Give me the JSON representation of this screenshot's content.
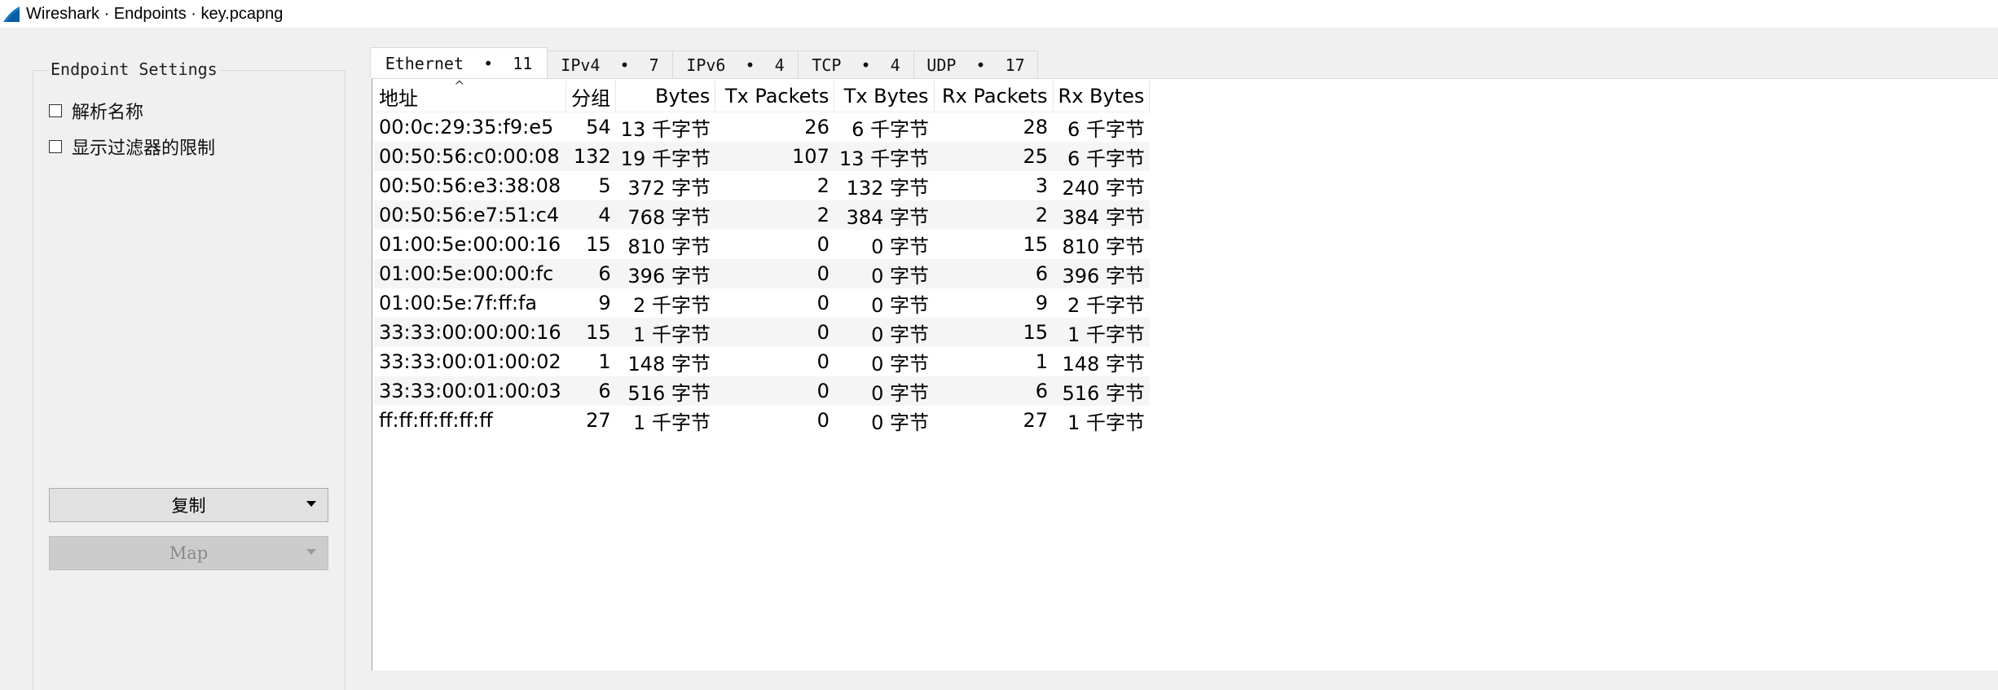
{
  "window": {
    "title": "Wireshark · Endpoints · key.pcapng"
  },
  "settings": {
    "group_title": "Endpoint Settings",
    "resolve_names": "解析名称",
    "limit_to_filter": "显示过滤器的限制",
    "copy_label": "复制",
    "map_label": "Map"
  },
  "tabs": [
    {
      "label": "Ethernet  •  11"
    },
    {
      "label": "IPv4  •  7"
    },
    {
      "label": "IPv6  •  4"
    },
    {
      "label": "TCP  •  4"
    },
    {
      "label": "UDP  •  17"
    }
  ],
  "table": {
    "headers": [
      "地址",
      "分组",
      "Bytes",
      "Tx Packets",
      "Tx Bytes",
      "Rx Packets",
      "Rx Bytes"
    ],
    "rows": [
      [
        "00:0c:29:35:f9:e5",
        "54",
        "13 千字节",
        "26",
        "6 千字节",
        "28",
        "6 千字节"
      ],
      [
        "00:50:56:c0:00:08",
        "132",
        "19 千字节",
        "107",
        "13 千字节",
        "25",
        "6 千字节"
      ],
      [
        "00:50:56:e3:38:08",
        "5",
        "372 字节",
        "2",
        "132 字节",
        "3",
        "240 字节"
      ],
      [
        "00:50:56:e7:51:c4",
        "4",
        "768 字节",
        "2",
        "384 字节",
        "2",
        "384 字节"
      ],
      [
        "01:00:5e:00:00:16",
        "15",
        "810 字节",
        "0",
        "0 字节",
        "15",
        "810 字节"
      ],
      [
        "01:00:5e:00:00:fc",
        "6",
        "396 字节",
        "0",
        "0 字节",
        "6",
        "396 字节"
      ],
      [
        "01:00:5e:7f:ff:fa",
        "9",
        "2 千字节",
        "0",
        "0 字节",
        "9",
        "2 千字节"
      ],
      [
        "33:33:00:00:00:16",
        "15",
        "1 千字节",
        "0",
        "0 字节",
        "15",
        "1 千字节"
      ],
      [
        "33:33:00:01:00:02",
        "1",
        "148 字节",
        "0",
        "0 字节",
        "1",
        "148 字节"
      ],
      [
        "33:33:00:01:00:03",
        "6",
        "516 字节",
        "0",
        "0 字节",
        "6",
        "516 字节"
      ],
      [
        "ff:ff:ff:ff:ff:ff",
        "27",
        "1 千字节",
        "0",
        "0 字节",
        "27",
        "1 千字节"
      ]
    ]
  }
}
